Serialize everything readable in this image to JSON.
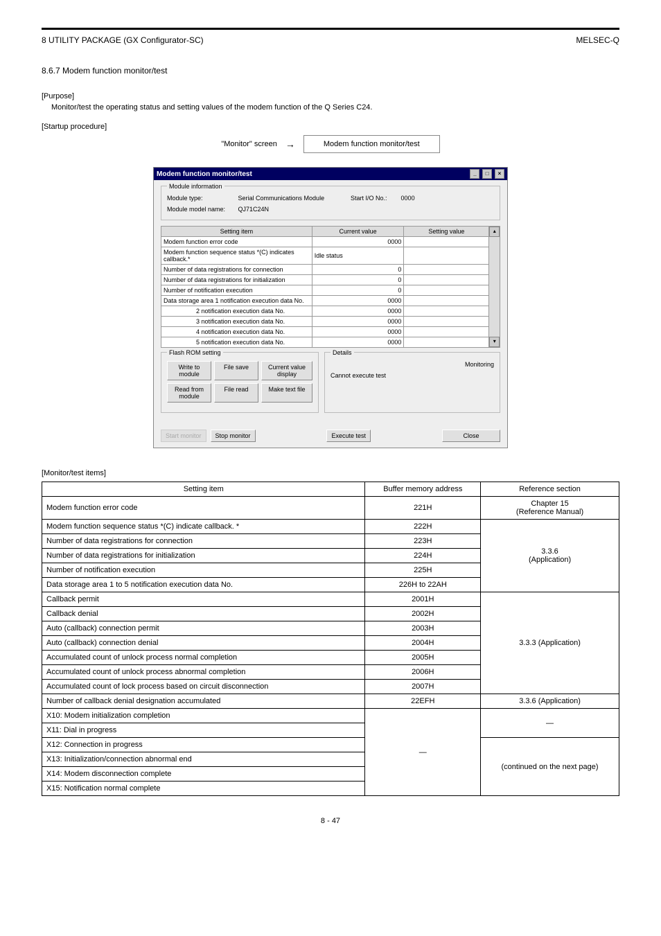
{
  "header": {
    "left": "8   UTILITY PACKAGE (GX Configurator-SC)",
    "right": "MELSEC-Q"
  },
  "section": "8.6.7 Modem function monitor/test",
  "purpose_label": "[Purpose]",
  "purpose_text": "Monitor/test the operating status and setting values of the modem function of the Q Series C24.",
  "nav_label": "[Startup procedure]",
  "nav_items": [
    "\"Monitor\" screen",
    "Modem function monitor/test"
  ],
  "dialog": {
    "title": "Modem function monitor/test",
    "modinfo": {
      "legend": "Module information",
      "type_lbl": "Module type:",
      "type_val": "Serial Communications Module",
      "io_lbl": "Start I/O No.:",
      "io_val": "0000",
      "model_lbl": "Module model name:",
      "model_val": "QJ71C24N"
    },
    "headers": {
      "item": "Setting item",
      "cur": "Current value",
      "set": "Setting value"
    },
    "rows": [
      {
        "item": "Modem function error code",
        "cur": "0000",
        "set": ""
      },
      {
        "item": "Modem function sequence status\n*(C) indicates callback.*",
        "cur": "Idle status",
        "set": ""
      },
      {
        "item": "Number of data registrations for connection",
        "cur": "0",
        "set": ""
      },
      {
        "item": "Number of data registrations for initialization",
        "cur": "0",
        "set": ""
      },
      {
        "item": "Number of notification execution",
        "cur": "0",
        "set": ""
      },
      {
        "item": "Data storage area 1 notification execution data No.",
        "cur": "0000",
        "set": ""
      },
      {
        "item": "2 notification execution data No.",
        "cur": "0000",
        "set": ""
      },
      {
        "item": "3 notification execution data No.",
        "cur": "0000",
        "set": ""
      },
      {
        "item": "4 notification execution data No.",
        "cur": "0000",
        "set": ""
      },
      {
        "item": "5 notification execution data No.",
        "cur": "0000",
        "set": ""
      }
    ],
    "flash": {
      "legend": "Flash ROM setting",
      "write": "Write to module",
      "save": "File save",
      "cvd": "Current value display",
      "read": "Read from module",
      "fread": "File read",
      "mtf": "Make text file"
    },
    "details": {
      "legend": "Details",
      "msg": "Cannot execute test",
      "mon": "Monitoring"
    },
    "footer": {
      "start": "Start monitor",
      "stop": "Stop monitor",
      "exec": "Execute test",
      "close": "Close"
    }
  },
  "spec_label": "[Monitor/test items]",
  "spec_headers": {
    "item": "Setting item",
    "addr": "Buffer memory address",
    "ref": "Reference section"
  },
  "spec_rows": [
    {
      "item": "Modem function error code",
      "addr": "221H",
      "ref": "Chapter 15\n(Reference Manual)"
    },
    {
      "item": "Modem function sequence status *(C) indicate callback. *",
      "addr": "222H",
      "ref": "3.3.6\n(Application)"
    },
    {
      "item": "Number of data registrations for connection",
      "addr": "223H",
      "ref": "3.3.6 (Application)"
    },
    {
      "item": "Number of data registrations for initialization",
      "addr": "224H",
      "ref": "3.3.6 (Application)"
    },
    {
      "item": "Number of notification execution",
      "addr": "225H",
      "ref": "3.3.6 (Application)"
    },
    {
      "item": "Data storage area 1 to 5 notification execution data No.",
      "addr": "226H to 22AH",
      "ref": "3.3.6 (Application)"
    },
    {
      "item": "Callback permit",
      "addr": "2001H",
      "ref": "3.3.3 (Application)"
    },
    {
      "item": "Callback denial",
      "addr": "2002H",
      "ref": "3.3.3 (Application)"
    },
    {
      "item": "Auto (callback) connection permit",
      "addr": "2003H",
      "ref": "3.3.3 (Application)"
    },
    {
      "item": "Auto (callback) connection denial",
      "addr": "2004H",
      "ref": "3.3.3 (Application)"
    },
    {
      "item": "Accumulated count of unlock process normal completion",
      "addr": "2005H",
      "ref": "3.3.3 (Application)"
    },
    {
      "item": "Accumulated count of unlock process abnormal completion",
      "addr": "2006H",
      "ref": "3.3.3 (Application)"
    },
    {
      "item": "Accumulated count of lock process based on circuit disconnection",
      "addr": "2007H",
      "ref": "3.3.3 (Application)"
    },
    {
      "item": "Number of callback denial designation accumulated",
      "addr": "22EFH",
      "ref": "3.3.6 (Application)"
    },
    {
      "item": "X10: Modem initialization completion",
      "addr": "—",
      "ref": "—"
    },
    {
      "item": "X11: Dial in progress",
      "addr": "—",
      "ref": "—"
    },
    {
      "item": "X12: Connection in progress",
      "addr": "—",
      "ref": "(continued on the next page)"
    },
    {
      "item": "X13: Initialization/connection abnormal end",
      "addr": "—",
      "ref": "(continued on the next page)"
    },
    {
      "item": "X14: Modem disconnection complete",
      "addr": "—",
      "ref": "(continued on the next page)"
    },
    {
      "item": "X15: Notification normal complete",
      "addr": "—",
      "ref": "(continued on the next page)"
    }
  ],
  "pagenum": "8 - 47"
}
